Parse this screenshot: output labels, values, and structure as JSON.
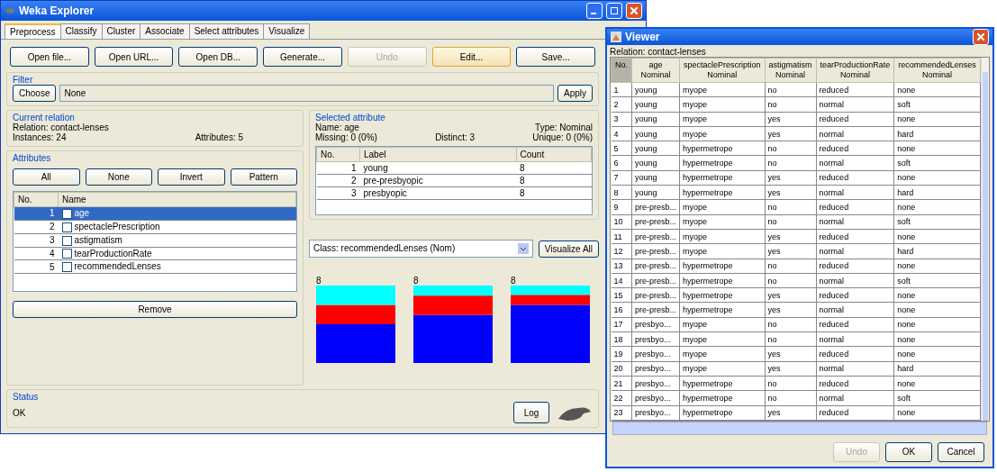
{
  "main_window": {
    "title": "Weka Explorer",
    "tabs": [
      {
        "label": "Preprocess",
        "selected": true
      },
      {
        "label": "Classify",
        "selected": false
      },
      {
        "label": "Cluster",
        "selected": false
      },
      {
        "label": "Associate",
        "selected": false
      },
      {
        "label": "Select attributes",
        "selected": false
      },
      {
        "label": "Visualize",
        "selected": false
      }
    ],
    "toolbar": [
      {
        "label": "Open file...",
        "disabled": false,
        "hovered": false
      },
      {
        "label": "Open URL...",
        "disabled": false,
        "hovered": false
      },
      {
        "label": "Open DB...",
        "disabled": false,
        "hovered": false
      },
      {
        "label": "Generate...",
        "disabled": false,
        "hovered": false
      },
      {
        "label": "Undo",
        "disabled": true,
        "hovered": false
      },
      {
        "label": "Edit...",
        "disabled": false,
        "hovered": true
      },
      {
        "label": "Save...",
        "disabled": false,
        "hovered": false
      }
    ],
    "filter": {
      "title": "Filter",
      "choose": "Choose",
      "value": "None",
      "apply": "Apply"
    },
    "current_relation": {
      "title": "Current relation",
      "relation": "Relation: contact-lenses",
      "instances": "Instances: 24",
      "attributes": "Attributes: 5"
    },
    "attributes": {
      "title": "Attributes",
      "buttons": [
        "All",
        "None",
        "Invert",
        "Pattern"
      ],
      "columns": [
        "No.",
        "Name"
      ],
      "rows": [
        {
          "no": "1",
          "name": "age",
          "checked": false,
          "selected": true
        },
        {
          "no": "2",
          "name": "spectaclePrescription",
          "checked": false,
          "selected": false
        },
        {
          "no": "3",
          "name": "astigmatism",
          "checked": false,
          "selected": false
        },
        {
          "no": "4",
          "name": "tearProductionRate",
          "checked": false,
          "selected": false
        },
        {
          "no": "5",
          "name": "recommendedLenses",
          "checked": false,
          "selected": false
        }
      ],
      "remove": "Remove"
    },
    "selected_attribute": {
      "title": "Selected attribute",
      "name": "Name: age",
      "type": "Type: Nominal",
      "missing": "Missing: 0 (0%)",
      "distinct": "Distinct: 3",
      "unique": "Unique: 0 (0%)",
      "columns": [
        "No.",
        "Label",
        "Count"
      ],
      "rows": [
        [
          "1",
          "young",
          "8"
        ],
        [
          "2",
          "pre-presbyopic",
          "8"
        ],
        [
          "3",
          "presbyopic",
          "8"
        ]
      ]
    },
    "class_select": {
      "value": "Class: recommendedLenses (Nom)",
      "button": "Visualize All"
    },
    "bar_labels": [
      "8",
      "8",
      "8"
    ],
    "status": {
      "title": "Status",
      "text": "OK",
      "log": "Log"
    }
  },
  "viewer": {
    "title": "Viewer",
    "relation": "Relation: contact-lenses",
    "columns": [
      {
        "name": "No."
      },
      {
        "name": "age",
        "type": "Nominal"
      },
      {
        "name": "spectaclePrescription",
        "type": "Nominal"
      },
      {
        "name": "astigmatism",
        "type": "Nominal"
      },
      {
        "name": "tearProductionRate",
        "type": "Nominal"
      },
      {
        "name": "recommendedLenses",
        "type": "Nominal"
      }
    ],
    "rows": [
      [
        "1",
        "young",
        "myope",
        "no",
        "reduced",
        "none"
      ],
      [
        "2",
        "young",
        "myope",
        "no",
        "normal",
        "soft"
      ],
      [
        "3",
        "young",
        "myope",
        "yes",
        "reduced",
        "none"
      ],
      [
        "4",
        "young",
        "myope",
        "yes",
        "normal",
        "hard"
      ],
      [
        "5",
        "young",
        "hypermetrope",
        "no",
        "reduced",
        "none"
      ],
      [
        "6",
        "young",
        "hypermetrope",
        "no",
        "normal",
        "soft"
      ],
      [
        "7",
        "young",
        "hypermetrope",
        "yes",
        "reduced",
        "none"
      ],
      [
        "8",
        "young",
        "hypermetrope",
        "yes",
        "normal",
        "hard"
      ],
      [
        "9",
        "pre-presb...",
        "myope",
        "no",
        "reduced",
        "none"
      ],
      [
        "10",
        "pre-presb...",
        "myope",
        "no",
        "normal",
        "soft"
      ],
      [
        "11",
        "pre-presb...",
        "myope",
        "yes",
        "reduced",
        "none"
      ],
      [
        "12",
        "pre-presb...",
        "myope",
        "yes",
        "normal",
        "hard"
      ],
      [
        "13",
        "pre-presb...",
        "hypermetrope",
        "no",
        "reduced",
        "none"
      ],
      [
        "14",
        "pre-presb...",
        "hypermetrope",
        "no",
        "normal",
        "soft"
      ],
      [
        "15",
        "pre-presb...",
        "hypermetrope",
        "yes",
        "reduced",
        "none"
      ],
      [
        "16",
        "pre-presb...",
        "hypermetrope",
        "yes",
        "normal",
        "none"
      ],
      [
        "17",
        "presbyo...",
        "myope",
        "no",
        "reduced",
        "none"
      ],
      [
        "18",
        "presbyo...",
        "myope",
        "no",
        "normal",
        "none"
      ],
      [
        "19",
        "presbyo...",
        "myope",
        "yes",
        "reduced",
        "none"
      ],
      [
        "20",
        "presbyo...",
        "myope",
        "yes",
        "normal",
        "hard"
      ],
      [
        "21",
        "presbyo...",
        "hypermetrope",
        "no",
        "reduced",
        "none"
      ],
      [
        "22",
        "presbyo...",
        "hypermetrope",
        "no",
        "normal",
        "soft"
      ],
      [
        "23",
        "presbyo...",
        "hypermetrope",
        "yes",
        "reduced",
        "none"
      ]
    ],
    "buttons": [
      {
        "label": "Undo",
        "disabled": true
      },
      {
        "label": "OK",
        "disabled": false
      },
      {
        "label": "Cancel",
        "disabled": false
      }
    ]
  }
}
